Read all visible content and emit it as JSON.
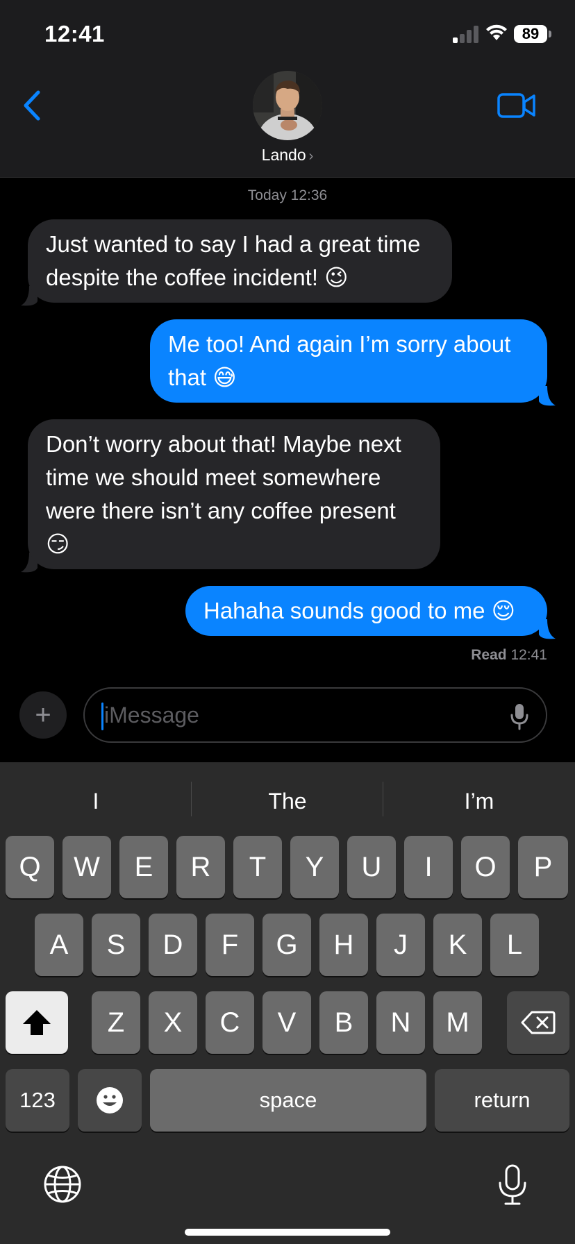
{
  "status_bar": {
    "time": "12:41",
    "battery": "89"
  },
  "header": {
    "contact_name": "Lando",
    "chevron": "›",
    "back_icon": "chevron-left-icon",
    "video_icon": "video-camera-icon"
  },
  "thread": {
    "service": "iMessage",
    "timestamp": "Today 12:36",
    "messages": [
      {
        "direction": "in",
        "lines": [
          "Just wanted to say I had a great time",
          "despite the coffee incident! 😉"
        ]
      },
      {
        "direction": "out",
        "lines": [
          "Me too! And again I’m sorry about",
          "that 😅"
        ]
      },
      {
        "direction": "in",
        "lines": [
          "Don’t worry about that! Maybe next",
          "time we should meet somewhere",
          "were there isn’t any coffee present",
          "😏"
        ]
      },
      {
        "direction": "out",
        "lines": [
          "Hahaha sounds good to me 😌"
        ]
      }
    ],
    "read_label": "Read",
    "read_time": "12:41"
  },
  "composer": {
    "plus": "+",
    "placeholder": "iMessage"
  },
  "keyboard": {
    "suggestions": [
      "I",
      "The",
      "I’m"
    ],
    "row1": [
      "Q",
      "W",
      "E",
      "R",
      "T",
      "Y",
      "U",
      "I",
      "O",
      "P"
    ],
    "row2": [
      "A",
      "S",
      "D",
      "F",
      "G",
      "H",
      "J",
      "K",
      "L"
    ],
    "row3": [
      "Z",
      "X",
      "C",
      "V",
      "B",
      "N",
      "M"
    ],
    "numbers": "123",
    "space": "space",
    "return": "return"
  },
  "colors": {
    "accent": "#0a84ff",
    "incoming_bubble": "#262629",
    "background": "#000000"
  }
}
